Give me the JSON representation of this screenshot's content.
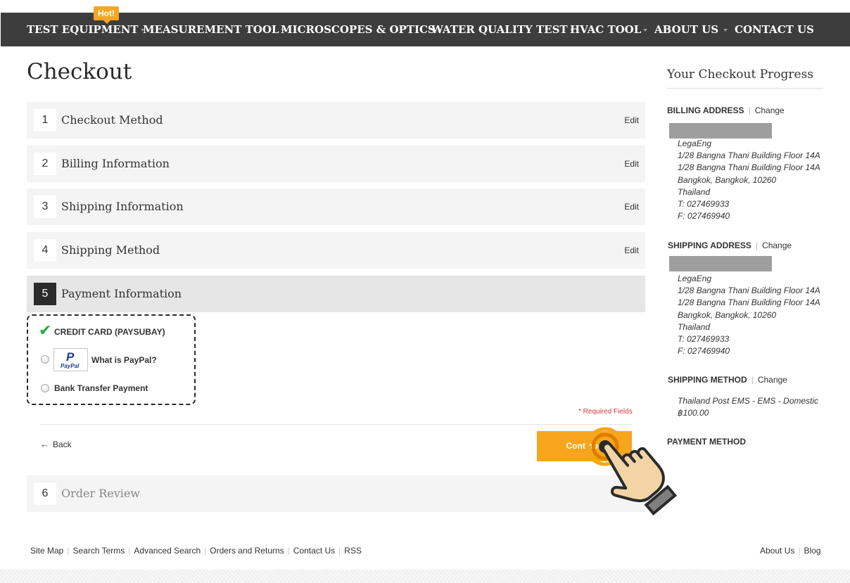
{
  "nav": {
    "hot_badge": "Hot!",
    "items": [
      {
        "label": "TEST EQUIPMENT"
      },
      {
        "label": "MEASUREMENT TOOL"
      },
      {
        "label": "MICROSCOPES & OPTICS"
      },
      {
        "label": "WATER QUALITY TEST"
      },
      {
        "label": "HVAC TOOL"
      },
      {
        "label": "ABOUT US"
      },
      {
        "label": "CONTACT US"
      }
    ]
  },
  "page": {
    "title": "Checkout"
  },
  "steps": [
    {
      "number": "1",
      "title": "Checkout Method",
      "edit": "Edit"
    },
    {
      "number": "2",
      "title": "Billing Information",
      "edit": "Edit"
    },
    {
      "number": "3",
      "title": "Shipping Information",
      "edit": "Edit"
    },
    {
      "number": "4",
      "title": "Shipping Method",
      "edit": "Edit"
    },
    {
      "number": "5",
      "title": "Payment Information",
      "edit": ""
    },
    {
      "number": "6",
      "title": "Order Review",
      "edit": ""
    }
  ],
  "payment": {
    "options": [
      {
        "label": "CREDIT CARD (PAYSUBAY)",
        "selected": true
      },
      {
        "label": "What is PayPal?",
        "logo": "PayPal",
        "selected": false
      },
      {
        "label": "Bank Transfer Payment",
        "selected": false
      }
    ],
    "required_note": "* Required Fields",
    "back_label": "Back",
    "continue_label": "Continue"
  },
  "sidebar": {
    "title": "Your Checkout Progress",
    "change_label": "Change",
    "billing": {
      "heading": "BILLING ADDRESS",
      "lines": [
        "LegaEng",
        "1/28 Bangna Thani Building Floor 14A",
        "1/28 Bangna Thani Building Floor 14A",
        "Bangkok, Bangkok, 10260",
        "Thailand",
        "T: 027469933",
        "F: 027469940"
      ]
    },
    "shipping": {
      "heading": "SHIPPING ADDRESS",
      "lines": [
        "LegaEng",
        "1/28 Bangna Thani Building Floor 14A",
        "1/28 Bangna Thani Building Floor 14A",
        "Bangkok, Bangkok, 10260",
        "Thailand",
        "T: 027469933",
        "F: 027469940"
      ]
    },
    "shipping_method": {
      "heading": "SHIPPING METHOD",
      "lines": [
        "Thailand Post EMS - EMS - Domestic",
        "฿100.00"
      ]
    },
    "payment_method": {
      "heading": "PAYMENT METHOD"
    }
  },
  "footer": {
    "left_links": [
      "Site Map",
      "Search Terms",
      "Advanced Search",
      "Orders and Returns",
      "Contact Us",
      "RSS"
    ],
    "right_links": [
      "About Us",
      "Blog"
    ]
  },
  "colors": {
    "nav_bg": "#3d3d3d",
    "accent": "#f6a51c",
    "check": "#27a84a",
    "required": "#d9363e"
  },
  "icons": [
    "caret-down-icon",
    "check-icon",
    "paypal-logo",
    "back-arrow-icon",
    "hand-pointer-icon"
  ]
}
